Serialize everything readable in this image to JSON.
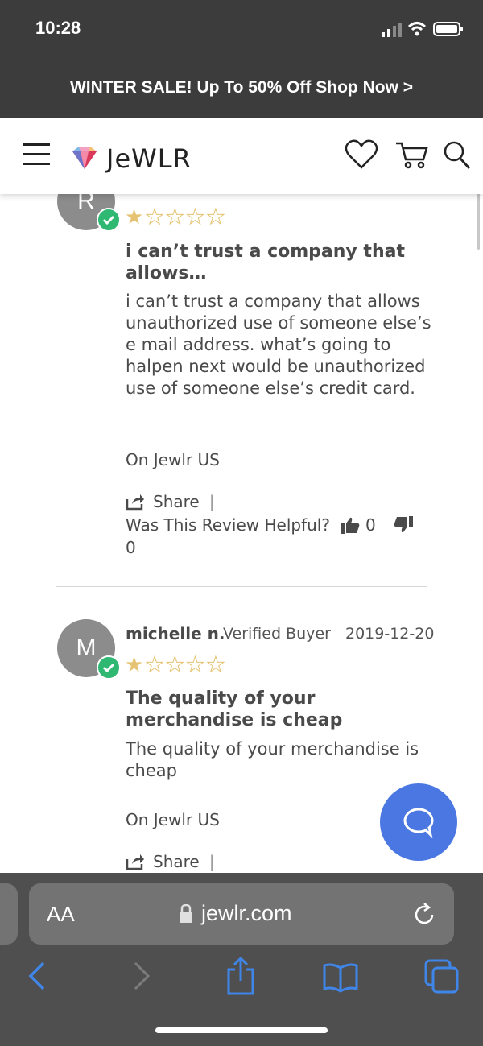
{
  "status": {
    "time": "10:28"
  },
  "promo": {
    "text": "WINTER SALE! Up To 50% Off Shop Now >"
  },
  "header": {
    "logo_text": "JeWLR"
  },
  "reviews": [
    {
      "avatar_initial": "R",
      "rating": 1,
      "title": "i can’t trust a company that allows…",
      "body": "i can’t trust a company that allows unauthorized use of someone else’s e mail address. what’s going to halpen next would be unauthorized use of someone else’s credit card.",
      "store": "On Jewlr US",
      "share_label": "Share",
      "helpful_label": "Was This Review Helpful?",
      "helpful_up": "0",
      "helpful_down": "0"
    },
    {
      "avatar_initial": "M",
      "name": "michelle n.",
      "verified": "Verified Buyer",
      "date": "2019-12-20",
      "rating": 1,
      "title": "The quality of your merchandise is cheap",
      "body": "The quality of your merchandise is cheap",
      "store": "On Jewlr US",
      "share_label": "Share"
    }
  ],
  "browser": {
    "aa_label": "AA",
    "domain": "jewlr.com"
  },
  "colors": {
    "dark_bar": "#3c3c3c",
    "star": "#e5c372",
    "verified_check": "#2eb872",
    "chat_button": "#4a77e1",
    "toolbar_icons": "#3f86e8"
  }
}
